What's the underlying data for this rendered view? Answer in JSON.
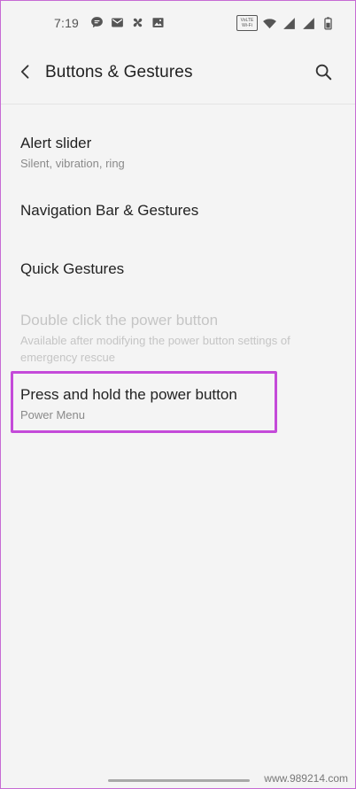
{
  "status_bar": {
    "time": "7:19",
    "left_icons": [
      "chat-bubble-icon",
      "mail-icon",
      "fan-icon",
      "image-icon"
    ],
    "right_icons": [
      "volte-wifi-icon",
      "wifi-icon",
      "signal-icon",
      "signal-icon",
      "battery-icon"
    ],
    "volte_label_1": "VoLTE",
    "volte_label_2": "Wi-Fi"
  },
  "app_bar": {
    "title": "Buttons & Gestures",
    "back_icon": "back-arrow-icon",
    "search_icon": "search-icon"
  },
  "settings": {
    "items": [
      {
        "title": "Alert slider",
        "subtitle": "Silent, vibration, ring",
        "enabled": true
      },
      {
        "title": "Navigation Bar & Gestures",
        "subtitle": "",
        "enabled": true
      },
      {
        "title": "Quick Gestures",
        "subtitle": "",
        "enabled": true
      },
      {
        "title": "Double click the power button",
        "subtitle": "Available after modifying the power button settings of emergency rescue",
        "enabled": false
      },
      {
        "title": "Press and hold the power button",
        "subtitle": "Power Menu",
        "enabled": true,
        "highlighted": true
      }
    ]
  },
  "colors": {
    "highlight": "#c44ad9",
    "background": "#f4f4f4",
    "disabled_text": "#c5c5c5"
  },
  "watermark": "www.989214.com"
}
